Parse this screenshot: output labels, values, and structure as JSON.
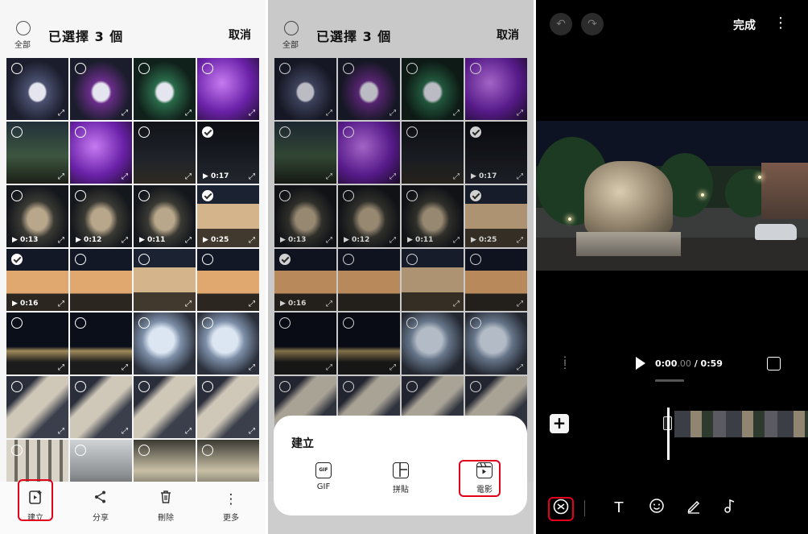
{
  "panels": [
    {
      "header": {
        "select_all_label": "全部",
        "title": "已選擇 3 個",
        "cancel_label": "取消"
      },
      "tiles": [
        {
          "thumb": "t-group",
          "checked": false,
          "duration": "",
          "expand": true
        },
        {
          "thumb": "t-group2",
          "checked": false,
          "duration": "",
          "expand": true
        },
        {
          "thumb": "t-group3",
          "checked": false,
          "duration": "",
          "expand": true
        },
        {
          "thumb": "t-purple",
          "checked": false,
          "duration": "",
          "expand": true
        },
        {
          "thumb": "t-park",
          "checked": false,
          "duration": "",
          "expand": true
        },
        {
          "thumb": "t-purple",
          "checked": false,
          "duration": "",
          "expand": true
        },
        {
          "thumb": "t-dark",
          "checked": false,
          "duration": "",
          "expand": true
        },
        {
          "thumb": "t-dark2",
          "checked": true,
          "duration": "0:17",
          "expand": true
        },
        {
          "thumb": "t-lion",
          "checked": false,
          "duration": "0:13",
          "expand": true
        },
        {
          "thumb": "t-lion",
          "checked": false,
          "duration": "0:12",
          "expand": true
        },
        {
          "thumb": "t-lion",
          "checked": false,
          "duration": "0:11",
          "expand": true
        },
        {
          "thumb": "t-building",
          "checked": true,
          "duration": "0:25",
          "expand": true
        },
        {
          "thumb": "t-building2",
          "checked": true,
          "duration": "0:16",
          "expand": true
        },
        {
          "thumb": "t-building2",
          "checked": false,
          "duration": "",
          "expand": false
        },
        {
          "thumb": "t-building",
          "checked": false,
          "duration": "",
          "expand": true
        },
        {
          "thumb": "t-building2",
          "checked": false,
          "duration": "",
          "expand": true
        },
        {
          "thumb": "t-city",
          "checked": false,
          "duration": "",
          "expand": true
        },
        {
          "thumb": "t-city",
          "checked": false,
          "duration": "",
          "expand": true
        },
        {
          "thumb": "t-mascot",
          "checked": false,
          "duration": "",
          "expand": false
        },
        {
          "thumb": "t-mascot",
          "checked": false,
          "duration": "",
          "expand": true
        },
        {
          "thumb": "t-arcade",
          "checked": false,
          "duration": "",
          "expand": true
        },
        {
          "thumb": "t-arcade",
          "checked": false,
          "duration": "",
          "expand": true
        },
        {
          "thumb": "t-arcade",
          "checked": false,
          "duration": "",
          "expand": true
        },
        {
          "thumb": "t-arcade",
          "checked": false,
          "duration": "",
          "expand": true
        },
        {
          "thumb": "t-stone",
          "checked": false,
          "duration": "",
          "expand": false
        },
        {
          "thumb": "t-water",
          "checked": false,
          "duration": "",
          "expand": false
        },
        {
          "thumb": "t-old",
          "checked": false,
          "duration": "",
          "expand": false
        },
        {
          "thumb": "t-old",
          "checked": false,
          "duration": "",
          "expand": false
        }
      ],
      "bottom_bar": {
        "create": "建立",
        "share": "分享",
        "delete": "刪除",
        "more": "更多"
      }
    },
    {
      "header": {
        "select_all_label": "全部",
        "title": "已選擇 3 個",
        "cancel_label": "取消"
      }
    }
  ],
  "create_sheet": {
    "title": "建立",
    "gif_badge": "GIF",
    "gif_label": "GIF",
    "collage_label": "拼貼",
    "movie_label": "電影"
  },
  "editor": {
    "done_label": "完成",
    "time_current": "0:00",
    "time_centis": ".00",
    "time_total": " / 0:59"
  },
  "icons": {
    "undo": "undo-icon",
    "redo": "redo-icon",
    "more": "more-vertical-icon",
    "play": "play-icon",
    "fit": "fit-screen-icon",
    "add": "plus-icon",
    "speed": "speed-icon",
    "text": "text-icon",
    "sticker": "sticker-icon",
    "draw": "draw-icon",
    "music": "music-icon",
    "create": "create-icon",
    "share": "share-icon",
    "delete": "trash-icon"
  },
  "colors": {
    "highlight": "#e3001b",
    "editor_bg": "#000000"
  }
}
